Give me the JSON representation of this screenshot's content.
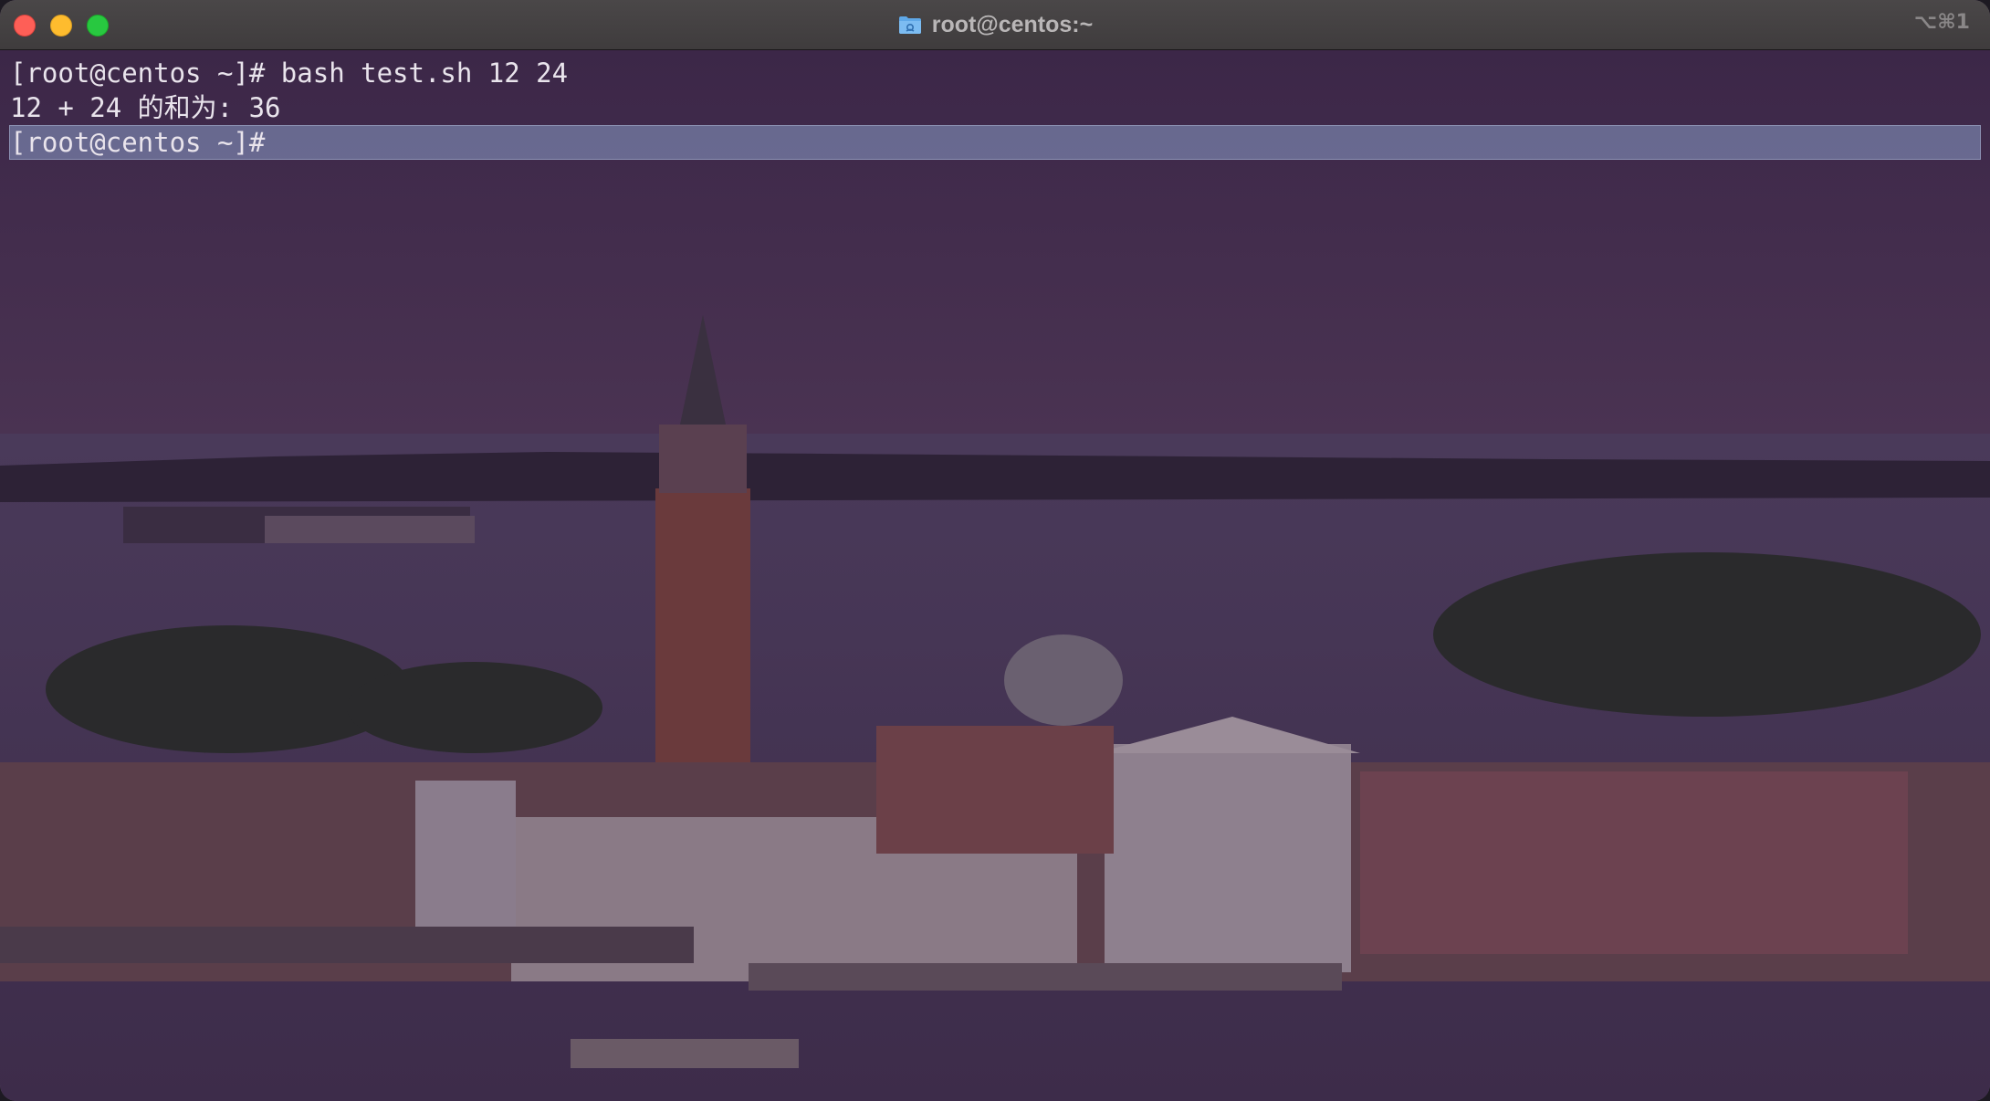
{
  "window": {
    "title": "root@centos:~",
    "shortcut": "⌥⌘1"
  },
  "terminal": {
    "lines": [
      "[root@centos ~]# bash test.sh 12 24",
      "12 + 24 的和为: 36",
      "[root@centos ~]#"
    ]
  },
  "colors": {
    "background_tint": "#3b2845",
    "active_line": "#6e7aa2",
    "text": "#e9e4ec"
  }
}
